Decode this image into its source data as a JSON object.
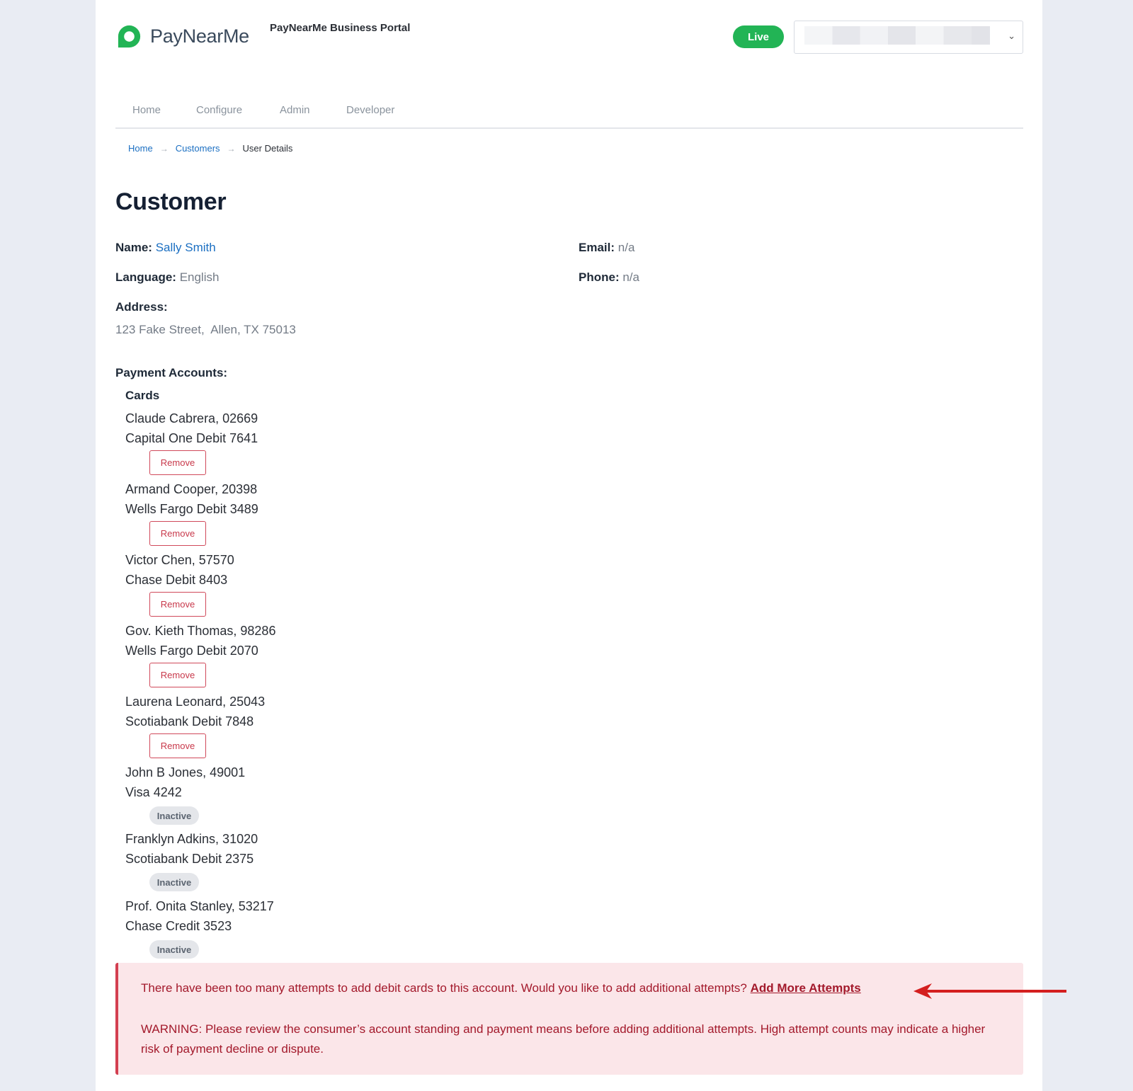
{
  "header": {
    "brand_name": "PayNearMe",
    "portal_title": "PayNearMe Business Portal",
    "environment_badge": "Live"
  },
  "nav": {
    "items": [
      "Home",
      "Configure",
      "Admin",
      "Developer"
    ]
  },
  "breadcrumb": {
    "items": [
      "Home",
      "Customers",
      "User Details"
    ],
    "separator": "→"
  },
  "customer": {
    "title": "Customer",
    "name_label": "Name:",
    "name_value": "Sally Smith",
    "email_label": "Email:",
    "email_value": "n/a",
    "language_label": "Language:",
    "language_value": "English",
    "phone_label": "Phone:",
    "phone_value": "n/a",
    "address_label": "Address:",
    "address_value": "123 Fake Street,  Allen, TX 75013"
  },
  "payment_accounts": {
    "label": "Payment Accounts:",
    "cards_label": "Cards",
    "remove_label": "Remove",
    "inactive_label": "Inactive",
    "cards": [
      {
        "holder": "Claude Cabrera, 02669",
        "card": "Capital One Debit 7641",
        "status": "active"
      },
      {
        "holder": "Armand Cooper, 20398",
        "card": "Wells Fargo Debit 3489",
        "status": "active"
      },
      {
        "holder": "Victor Chen, 57570",
        "card": "Chase Debit 8403",
        "status": "active"
      },
      {
        "holder": "Gov. Kieth Thomas, 98286",
        "card": "Wells Fargo Debit 2070",
        "status": "active"
      },
      {
        "holder": "Laurena Leonard, 25043",
        "card": "Scotiabank Debit 7848",
        "status": "active"
      },
      {
        "holder": "John B Jones, 49001",
        "card": "Visa 4242",
        "status": "inactive"
      },
      {
        "holder": "Franklyn Adkins, 31020",
        "card": "Scotiabank Debit 2375",
        "status": "inactive"
      },
      {
        "holder": "Prof. Onita Stanley, 53217",
        "card": "Chase Credit 3523",
        "status": "inactive"
      }
    ]
  },
  "alert": {
    "message": "There have been too many attempts to add debit cards to this account. Would you like to add additional attempts?",
    "link_label": "Add More Attempts",
    "warning": "WARNING: Please review the consumer’s account standing and payment means before adding additional attempts. High attempt counts may indicate a higher risk of payment decline or dispute."
  },
  "colors": {
    "brand_green": "#22b455",
    "link_blue": "#1b6fc2",
    "danger_red": "#c8394b",
    "alert_bg": "#fbe6e9",
    "annotation_arrow": "#d41f1f"
  }
}
